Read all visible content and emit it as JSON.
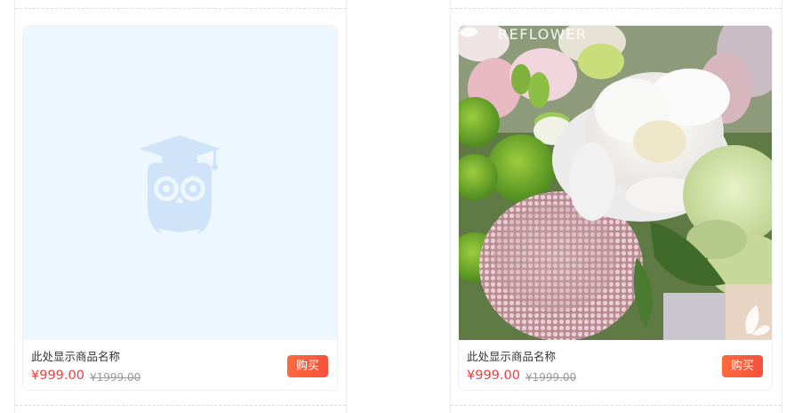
{
  "products": [
    {
      "name": "此处显示商品名称",
      "price": "¥999.00",
      "original_price": "¥1999.00",
      "buy_label": "购买",
      "image": "placeholder-owl-icon"
    },
    {
      "name": "此处显示商品名称",
      "price": "¥999.00",
      "original_price": "¥1999.00",
      "buy_label": "购买",
      "image": "flower-bouquet-photo",
      "brand_text": "REFLOWER"
    }
  ],
  "colors": {
    "price": "#f23c3c",
    "buy_button": "#f5503c",
    "placeholder_bg": "#eef6fe",
    "placeholder_icon": "#cfe4f8"
  }
}
